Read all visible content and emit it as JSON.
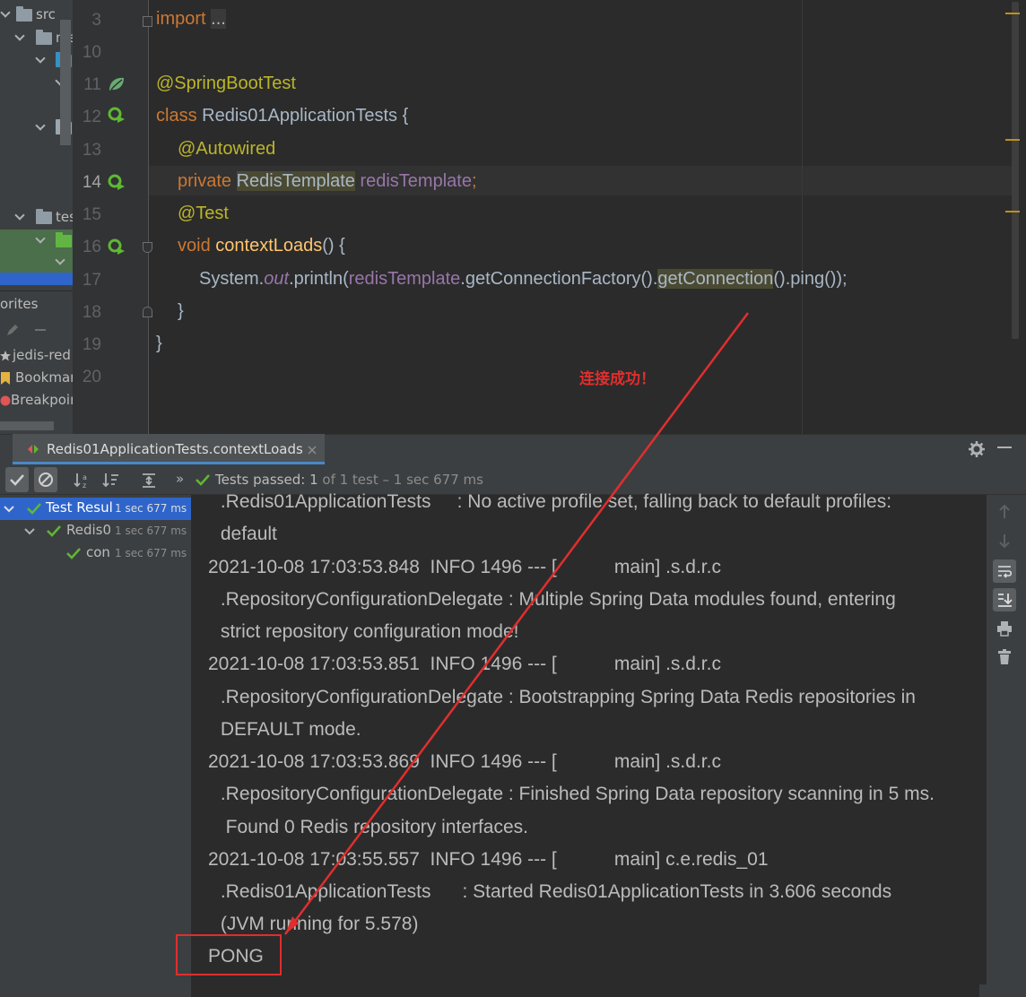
{
  "sidebar": {
    "tree": [
      {
        "label": "src"
      },
      {
        "label": "ma"
      },
      {
        "label": ""
      },
      {
        "label": ""
      },
      {
        "label": ""
      },
      {
        "label": "tes"
      },
      {
        "label": ""
      },
      {
        "label": ""
      }
    ],
    "favorites_title": "orites",
    "favorites": [
      {
        "label": "jedis-red"
      },
      {
        "label": "Bookmar"
      },
      {
        "label": "Breakpoir"
      }
    ]
  },
  "editor": {
    "line_numbers": [
      "3",
      "10",
      "11",
      "12",
      "13",
      "14",
      "15",
      "16",
      "17",
      "18",
      "19",
      "20"
    ],
    "code": {
      "l3_import": "import",
      "l3_dots": "...",
      "l11_ann": "@SpringBootTest",
      "l12_kw": "class",
      "l12_name": "Redis01ApplicationTests {",
      "l13_ann": "@Autowired",
      "l14_kw": "private",
      "l14_type": "RedisTemplate",
      "l14_field": "redisTemplate",
      "l14_semi": ";",
      "l15_ann": "@Test",
      "l16_kw": "void",
      "l16_fn": "contextLoads",
      "l16_rest": "() {",
      "l17_a": "System.",
      "l17_out": "out",
      "l17_b": ".println(",
      "l17_field": "redisTemplate",
      "l17_c": ".getConnectionFactory().",
      "l17_hl": "getConnection",
      "l17_d": "().ping());",
      "l18": "}",
      "l19": "}"
    },
    "annotation_note": "连接成功！"
  },
  "run": {
    "tab_label": "Redis01ApplicationTests.contextLoads",
    "status_prefix": "Tests passed:",
    "status_count": "1",
    "status_suffix": "of 1 test – 1 sec 677 ms",
    "tree": [
      {
        "label": "Test Resul",
        "time": "1 sec 677 ms"
      },
      {
        "label": "Redis0",
        "time": "1 sec 677 ms"
      },
      {
        "label": "con",
        "time": "1 sec 677 ms"
      }
    ],
    "console_lines": [
      " .Redis01ApplicationTests     : No active profile set, falling back to default profiles:",
      " default",
      "2021-10-08 17:03:53.848  INFO 1496 --- [           main] .s.d.r.c",
      " .RepositoryConfigurationDelegate : Multiple Spring Data modules found, entering",
      " strict repository configuration mode!",
      "2021-10-08 17:03:53.851  INFO 1496 --- [           main] .s.d.r.c",
      " .RepositoryConfigurationDelegate : Bootstrapping Spring Data Redis repositories in",
      " DEFAULT mode.",
      "2021-10-08 17:03:53.869  INFO 1496 --- [           main] .s.d.r.c",
      " .RepositoryConfigurationDelegate : Finished Spring Data repository scanning in 5 ms.",
      "  Found 0 Redis repository interfaces.",
      "2021-10-08 17:03:55.557  INFO 1496 --- [           main] c.e.redis_01",
      " .Redis01ApplicationTests      : Started Redis01ApplicationTests in 3.606 seconds",
      " (JVM running for 5.578)",
      "PONG"
    ]
  },
  "colors": {
    "annotation_red": "#e02e2e",
    "pass_green": "#5fb832",
    "spring_green": "#6aab73"
  }
}
